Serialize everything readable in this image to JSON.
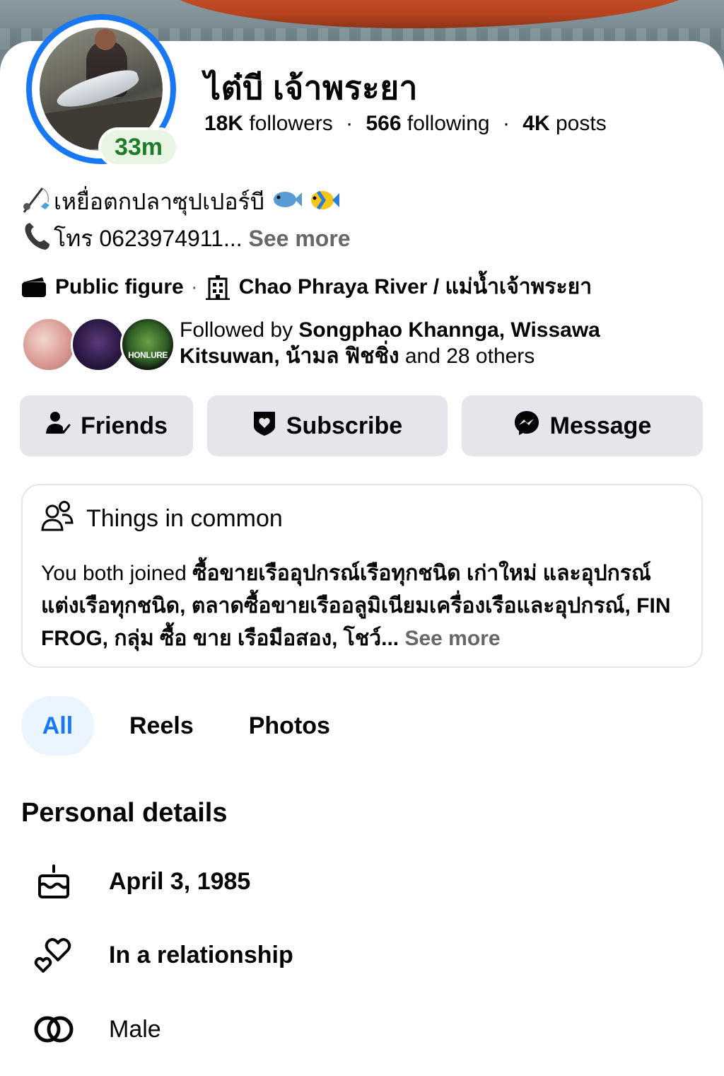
{
  "profile": {
    "name": "ไต๋บี เจ้าพระยา",
    "active_badge": "33m",
    "stats": {
      "followers_count": "18K",
      "followers_label": "followers",
      "following_count": "566",
      "following_label": "following",
      "posts_count": "4K",
      "posts_label": "posts",
      "separator": "·"
    },
    "bio": {
      "line1": "เหยื่อตกปลาซุปเปอร์บี",
      "line2": "โทร 0623974911...",
      "see_more": "See more"
    },
    "category": "Public figure",
    "location": "Chao Phraya River / แม่น้ำเจ้าพระยา",
    "meta_separator": "·",
    "mutual_logo_text": "HONLURE",
    "followed_by": {
      "prefix": "Followed by",
      "names": "Songphao Khannga, Wissawa Kitsuwan, น้ามล ฟิชชิ่ง",
      "suffix": "and 28 others"
    }
  },
  "actions": {
    "friends": "Friends",
    "subscribe": "Subscribe",
    "message": "Message"
  },
  "common": {
    "title": "Things in common",
    "prefix": "You both joined",
    "groups": "ซื้อขายเรืออุปกรณ์เรือทุกชนิด เก่าใหม่ และอุปกรณ์แต่งเรือทุกชนิด, ตลาดซื้อขายเรืออลูมิเนียมเครื่องเรือและอุปกรณ์, FIN FROG, กลุ่ม ซื้อ ขาย เรือมือสอง, โชว์...",
    "see_more": "See more"
  },
  "tabs": {
    "all": "All",
    "reels": "Reels",
    "photos": "Photos"
  },
  "personal_details": {
    "title": "Personal details",
    "birthday": "April 3, 1985",
    "relationship": "In a relationship",
    "gender": "Male"
  },
  "colors": {
    "accent": "#1877f2",
    "button_bg": "#e4e6eb",
    "muted_text": "#65676b",
    "active_badge_text": "#1e7b2a"
  },
  "icons": {
    "category": "clapperboard-icon",
    "location": "building-icon",
    "friends": "person-check-icon",
    "subscribe": "shield-heart-icon",
    "message": "messenger-icon",
    "common": "people-icon",
    "birthday": "cake-icon",
    "relationship": "hearts-icon",
    "gender": "rings-icon"
  }
}
